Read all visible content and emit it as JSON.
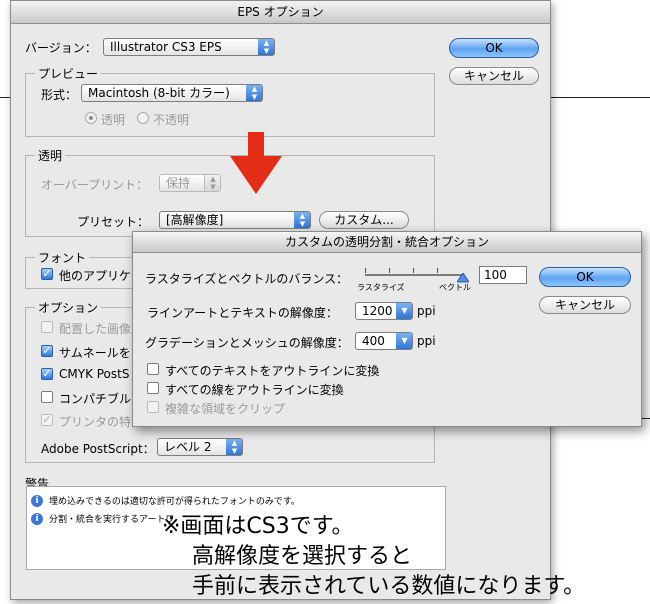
{
  "main_window": {
    "title": "EPS オプション",
    "version_label": "バージョン：",
    "version_value": "Illustrator CS3 EPS",
    "ok": "OK",
    "cancel": "キャンセル",
    "preview": {
      "title": "プレビュー",
      "format_label": "形式：",
      "format_value": "Macintosh (8-bit カラー)",
      "radio_transparent": "透明",
      "radio_opaque": "不透明"
    },
    "transparency": {
      "title": "透明",
      "overprint_label": "オーバープリント：",
      "overprint_value": "保持",
      "preset_label": "プリセット：",
      "preset_value": "[高解像度]",
      "custom_button": "カスタム..."
    },
    "font": {
      "title": "フォント",
      "embed_label": "他のアプリケ"
    },
    "options": {
      "title": "オプション",
      "item_linked": "配置した画像",
      "item_thumbnail": "サムネールを",
      "item_cmyk": "CMYK PostS",
      "item_compat": "コンパチブル",
      "item_printer": "プリンタの特",
      "ps_label": "Adobe PostScript：",
      "ps_value": "レベル 2"
    },
    "warnings": {
      "title": "警告",
      "items": [
        "埋め込みできるのは適切な許可が得られたフォントのみです。",
        "分割・統合を実行するアートワ"
      ]
    }
  },
  "custom_dialog": {
    "title": "カスタムの透明分割・統合オプション",
    "balance_label": "ラスタライズとベクトルのバランス：",
    "slider_left": "ラスタライズ",
    "slider_right": "ベクトル",
    "balance_value": "100",
    "balance_fraction": 1.0,
    "ok": "OK",
    "cancel": "キャンセル",
    "line_art_label": "ラインアートとテキストの解像度：",
    "line_art_value": "1200",
    "gradient_label": "グラデーションとメッシュの解像度：",
    "gradient_value": "400",
    "unit": "ppi",
    "cb_text_outline": "すべてのテキストをアウトラインに変換",
    "cb_stroke_outline": "すべての線をアウトラインに変換",
    "cb_clip": "複雑な領域をクリップ"
  },
  "annotation": {
    "line1": "※画面はCS3です。",
    "line2": "高解像度を選択すると",
    "line3": "手前に表示されている数値になります。"
  },
  "colors": {
    "arrow": "#e32d17",
    "aqua": "#5fa3ef"
  }
}
